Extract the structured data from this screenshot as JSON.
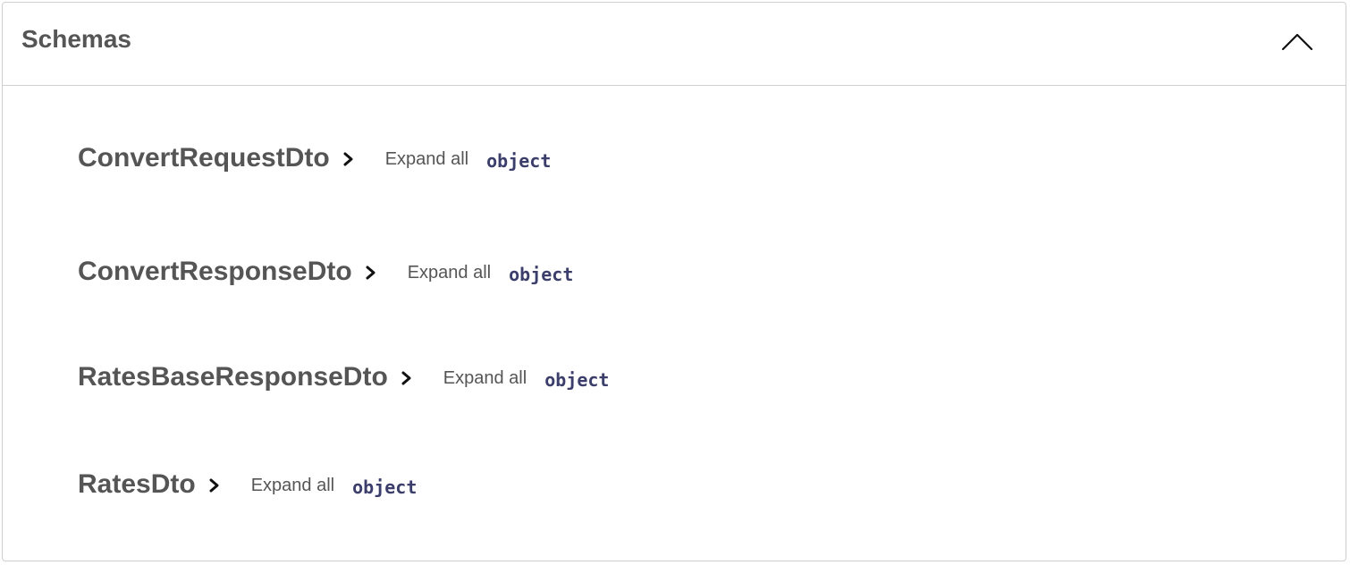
{
  "section": {
    "title": "Schemas",
    "toggle_icon": "chevron-up-icon"
  },
  "schemas": [
    {
      "name": "ConvertRequestDto",
      "expand_label": "Expand all",
      "type": "object"
    },
    {
      "name": "ConvertResponseDto",
      "expand_label": "Expand all",
      "type": "object"
    },
    {
      "name": "RatesBaseResponseDto",
      "expand_label": "Expand all",
      "type": "object"
    },
    {
      "name": "RatesDto",
      "expand_label": "Expand all",
      "type": "object"
    }
  ],
  "colors": {
    "title_text": "#555555",
    "type_text": "#3b3d6b",
    "border": "#cfcfcf"
  }
}
